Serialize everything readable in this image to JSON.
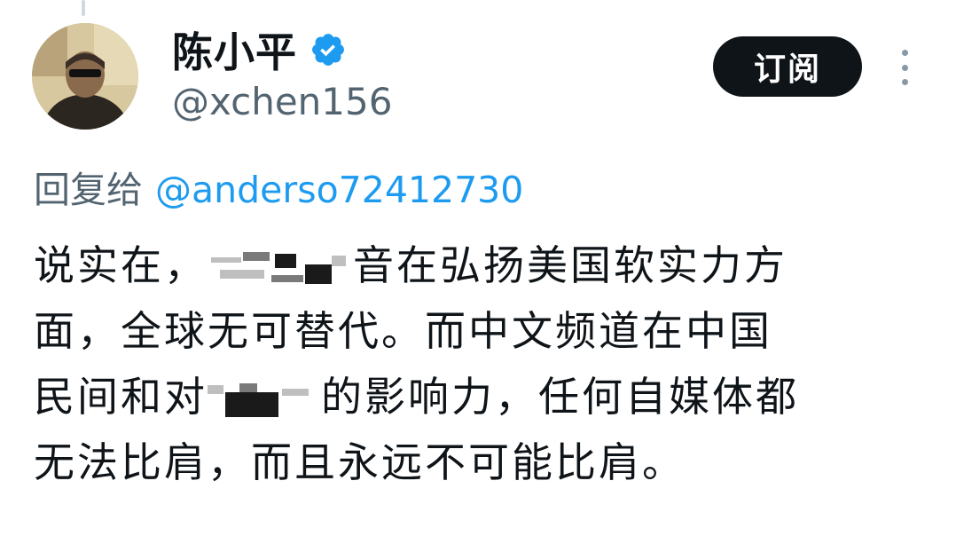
{
  "author": {
    "display_name": "陈小平",
    "handle": "@xchen156",
    "verified": true
  },
  "actions": {
    "subscribe_label": "订阅",
    "more_icon": "more-vertical-icon"
  },
  "reply": {
    "prefix": "回复给",
    "mention": "@anderso72412730"
  },
  "tweet": {
    "segments": {
      "line1_start": "说实在，",
      "line1_end": "音在弘扬美国软实力方",
      "line2": "面，全球无可替代。而中文频道在中国",
      "line3_start": "民间和对",
      "line3_end": "的影响力，任何自媒体都",
      "line4": "无法比肩，而且永远不可能比肩。"
    }
  },
  "colors": {
    "text": "#0f1419",
    "secondary": "#536471",
    "accent": "#1d9bf0",
    "button_bg": "#0f1419"
  }
}
